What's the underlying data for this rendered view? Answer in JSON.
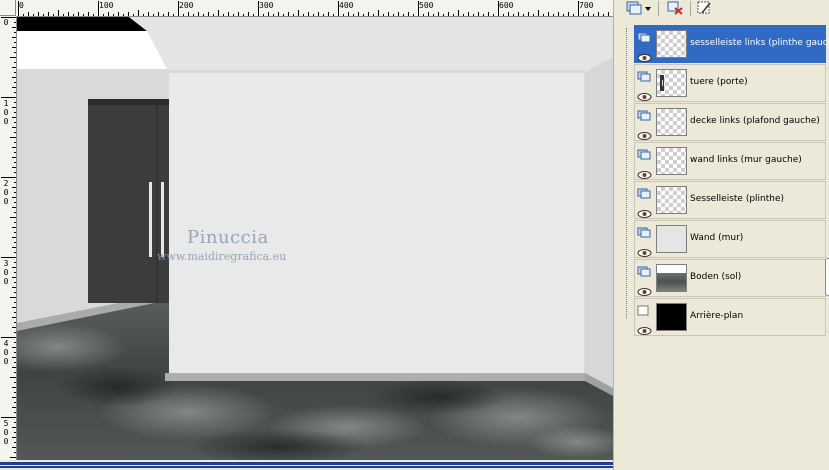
{
  "ruler": {
    "top_labels": [
      "0",
      "100",
      "200",
      "300",
      "400",
      "500",
      "600",
      "700"
    ],
    "left_labels": [
      [
        "0"
      ],
      [
        "1",
        "0",
        "0"
      ],
      [
        "2",
        "0",
        "0"
      ],
      [
        "3",
        "0",
        "0"
      ],
      [
        "4",
        "0",
        "0"
      ],
      [
        "5",
        "0",
        "0"
      ]
    ]
  },
  "canvas": {
    "watermark_line1": "Pinuccia",
    "watermark_line2": "www.maidiregrafica.eu"
  },
  "colors": {
    "selection": "#316ac5",
    "panel_bg": "#ece9d8",
    "scroll_bar": "#1f3f8f"
  },
  "layers_panel": {
    "toolbar_icons": [
      "new-layer-icon",
      "delete-layer-icon",
      "properties-icon"
    ],
    "layers": [
      {
        "name": "sesselleiste links (plinthe gauche)",
        "thumb": "transparent",
        "selected": true,
        "visible": true
      },
      {
        "name": "tuere (porte)",
        "thumb": "transparent",
        "selected": false,
        "visible": true
      },
      {
        "name": "decke links (plafond gauche)",
        "thumb": "transparent",
        "selected": false,
        "visible": true
      },
      {
        "name": "wand links (mur gauche)",
        "thumb": "transparent",
        "selected": false,
        "visible": true
      },
      {
        "name": "Sesselleiste (plinthe)",
        "thumb": "transparent",
        "selected": false,
        "visible": true
      },
      {
        "name": "Wand (mur)",
        "thumb": "light",
        "selected": false,
        "visible": true
      },
      {
        "name": "Boden (sol)",
        "thumb": "floor",
        "selected": false,
        "visible": true
      },
      {
        "name": "Arrière-plan",
        "thumb": "black",
        "selected": false,
        "visible": true
      }
    ]
  }
}
